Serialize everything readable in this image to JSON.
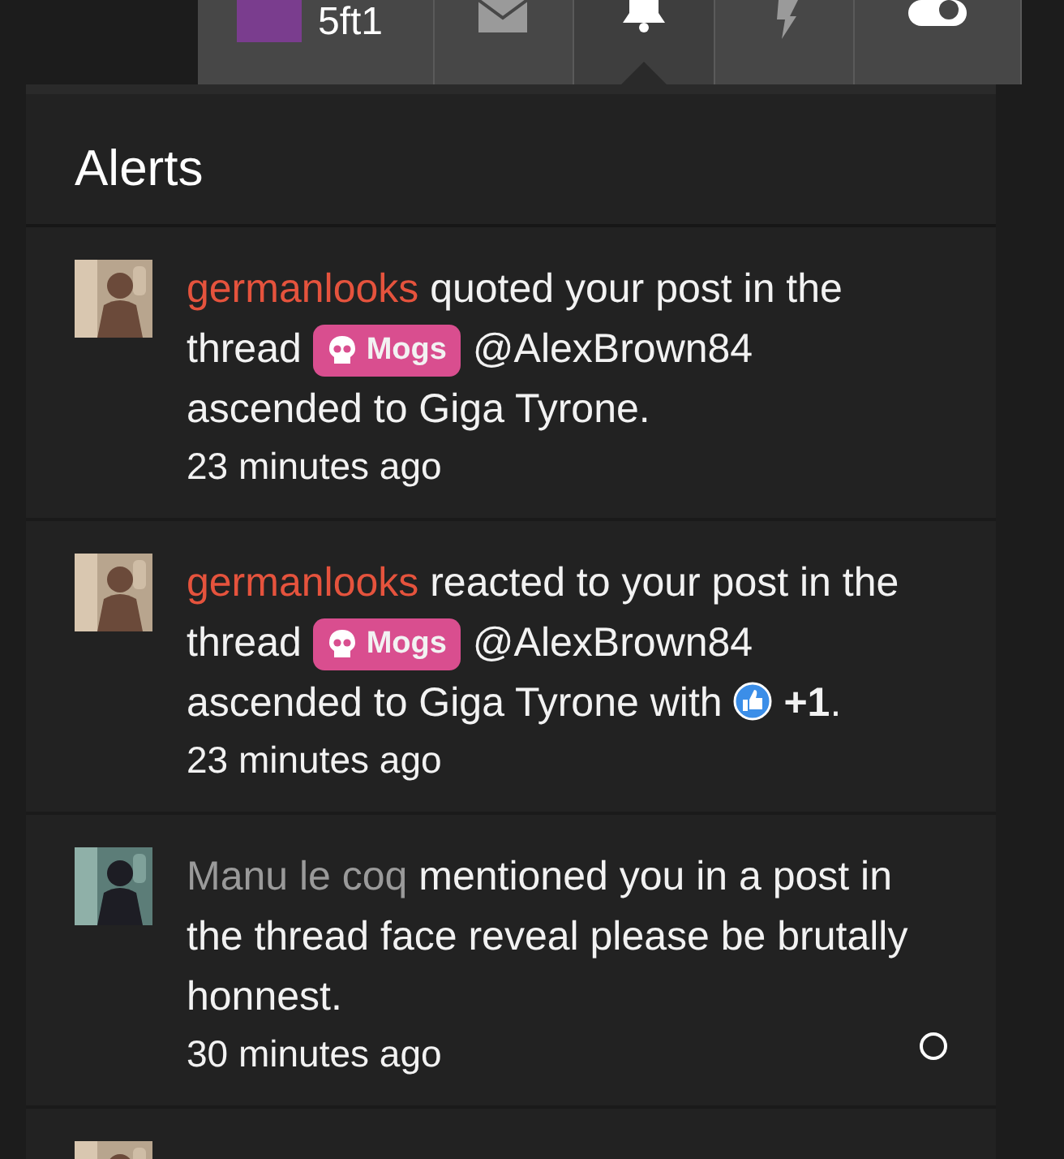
{
  "nav": {
    "user": {
      "name": "5ft1"
    },
    "items": [
      {
        "kind": "mail",
        "selected": false
      },
      {
        "kind": "bell",
        "selected": true
      },
      {
        "kind": "bolt",
        "selected": false
      },
      {
        "kind": "toggle",
        "selected": false
      }
    ]
  },
  "alerts": {
    "title": "Alerts",
    "items": [
      {
        "user": "germanlooks",
        "color": "#e5533d",
        "parts": [
          {
            "kind": "text",
            "text": "quoted your post in the thread"
          },
          {
            "kind": "prefix",
            "text": "Mogs"
          },
          {
            "kind": "text",
            "text": "@AlexBrown84 ascended to Giga Tyrone."
          }
        ],
        "time": "23 minutes ago",
        "read_toggle": false
      },
      {
        "user": "germanlooks",
        "color": "#e5533d",
        "parts": [
          {
            "kind": "text",
            "text": "reacted to your post in the thread"
          },
          {
            "kind": "prefix",
            "text": "Mogs"
          },
          {
            "kind": "text",
            "text": "@AlexBrown84 ascended to Giga Tyrone with"
          },
          {
            "kind": "reaction",
            "text": "+1"
          },
          {
            "kind": "punct",
            "text": "."
          }
        ],
        "time": "23 minutes ago",
        "read_toggle": false
      },
      {
        "user": "Manu le coq",
        "color": "#9a9a9a",
        "parts": [
          {
            "kind": "text",
            "text": "mentioned you in a post in the thread face reveal please be brutally honnest."
          }
        ],
        "time": "30 minutes ago",
        "read_toggle": true
      }
    ]
  }
}
